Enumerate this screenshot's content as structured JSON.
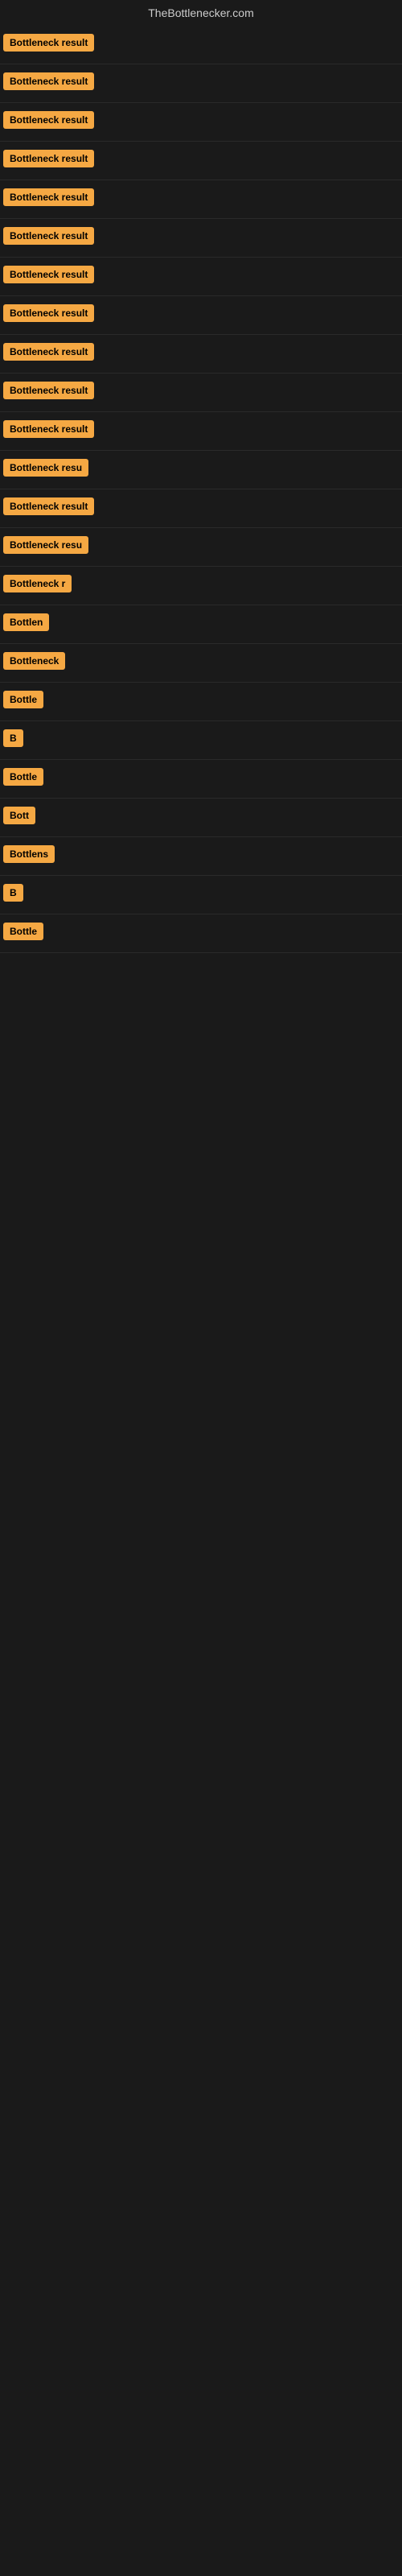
{
  "site": {
    "title": "TheBottlenecker.com"
  },
  "results": [
    {
      "id": 1,
      "label": "Bottleneck result",
      "visible_text": "Bottleneck result"
    },
    {
      "id": 2,
      "label": "Bottleneck result",
      "visible_text": "Bottleneck result"
    },
    {
      "id": 3,
      "label": "Bottleneck result",
      "visible_text": "Bottleneck result"
    },
    {
      "id": 4,
      "label": "Bottleneck result",
      "visible_text": "Bottleneck result"
    },
    {
      "id": 5,
      "label": "Bottleneck result",
      "visible_text": "Bottleneck result"
    },
    {
      "id": 6,
      "label": "Bottleneck result",
      "visible_text": "Bottleneck result"
    },
    {
      "id": 7,
      "label": "Bottleneck result",
      "visible_text": "Bottleneck result"
    },
    {
      "id": 8,
      "label": "Bottleneck result",
      "visible_text": "Bottleneck result"
    },
    {
      "id": 9,
      "label": "Bottleneck result",
      "visible_text": "Bottleneck result"
    },
    {
      "id": 10,
      "label": "Bottleneck result",
      "visible_text": "Bottleneck result"
    },
    {
      "id": 11,
      "label": "Bottleneck result",
      "visible_text": "Bottleneck result"
    },
    {
      "id": 12,
      "label": "Bottleneck resu",
      "visible_text": "Bottleneck resu"
    },
    {
      "id": 13,
      "label": "Bottleneck result",
      "visible_text": "Bottleneck result"
    },
    {
      "id": 14,
      "label": "Bottleneck resu",
      "visible_text": "Bottleneck resu"
    },
    {
      "id": 15,
      "label": "Bottleneck r",
      "visible_text": "Bottleneck r"
    },
    {
      "id": 16,
      "label": "Bottlen",
      "visible_text": "Bottlen"
    },
    {
      "id": 17,
      "label": "Bottleneck",
      "visible_text": "Bottleneck"
    },
    {
      "id": 18,
      "label": "Bottle",
      "visible_text": "Bottle"
    },
    {
      "id": 19,
      "label": "B",
      "visible_text": "B"
    },
    {
      "id": 20,
      "label": "Bottle",
      "visible_text": "Bottle"
    },
    {
      "id": 21,
      "label": "Bott",
      "visible_text": "Bott"
    },
    {
      "id": 22,
      "label": "Bottlens",
      "visible_text": "Bottlens"
    },
    {
      "id": 23,
      "label": "B",
      "visible_text": "B"
    },
    {
      "id": 24,
      "label": "Bottle",
      "visible_text": "Bottle"
    }
  ]
}
